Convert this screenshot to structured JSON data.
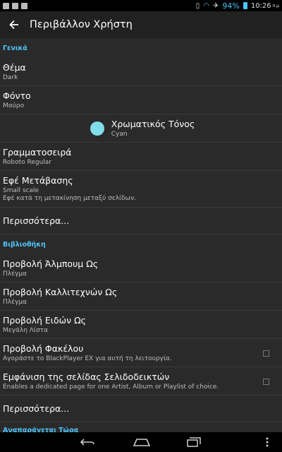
{
  "status_bar": {
    "battery_percent": "94%",
    "time": "10:26",
    "ampm": "π.μ"
  },
  "app_bar": {
    "title": "Περιβάλλον Χρήστη"
  },
  "sections": {
    "general": {
      "header": "Γενικά",
      "items": [
        {
          "title": "Θέμα",
          "sub": "Dark"
        },
        {
          "title": "Φόντο",
          "sub": "Μαύρο"
        },
        {
          "title": "Χρωματικός Τόνος",
          "sub": "Cyan",
          "swatch": "#80deea"
        },
        {
          "title": "Γραμματοσειρά",
          "sub": "Roboto Regular"
        },
        {
          "title": "Εφέ Μετάβασης",
          "sub": "Small scale",
          "sub2": "Εφέ κατά τη μετακίνηση μεταξύ σελίδων."
        }
      ],
      "more": "Περισσότερα..."
    },
    "library": {
      "header": "Βιβλιοθήκη",
      "items": [
        {
          "title": "Προβολή Άλμπουμ Ως",
          "sub": "Πλέγμα"
        },
        {
          "title": "Προβολή Καλλιτεχνών Ως",
          "sub": "Πλέγμα"
        },
        {
          "title": "Προβολή Ειδών Ως",
          "sub": "Μεγάλη Λίστα"
        },
        {
          "title": "Προβολή Φακέλου",
          "sub": "Αγοράστε το BlackPlayer EX για αυτή τη λειτουργία."
        },
        {
          "title": "Εμφάνιση της σελίδας Σελιδοδεικτών",
          "sub": "Enables a dedicated page for one Artist, Album or Playlist of choice."
        }
      ],
      "more": "Περισσότερα..."
    },
    "now_playing": {
      "header": "Αναπαράγεται Τώρα"
    }
  },
  "colors": {
    "accent": "#4fc3f7",
    "app_bar": "#212121",
    "background": "#2a2a2a"
  }
}
